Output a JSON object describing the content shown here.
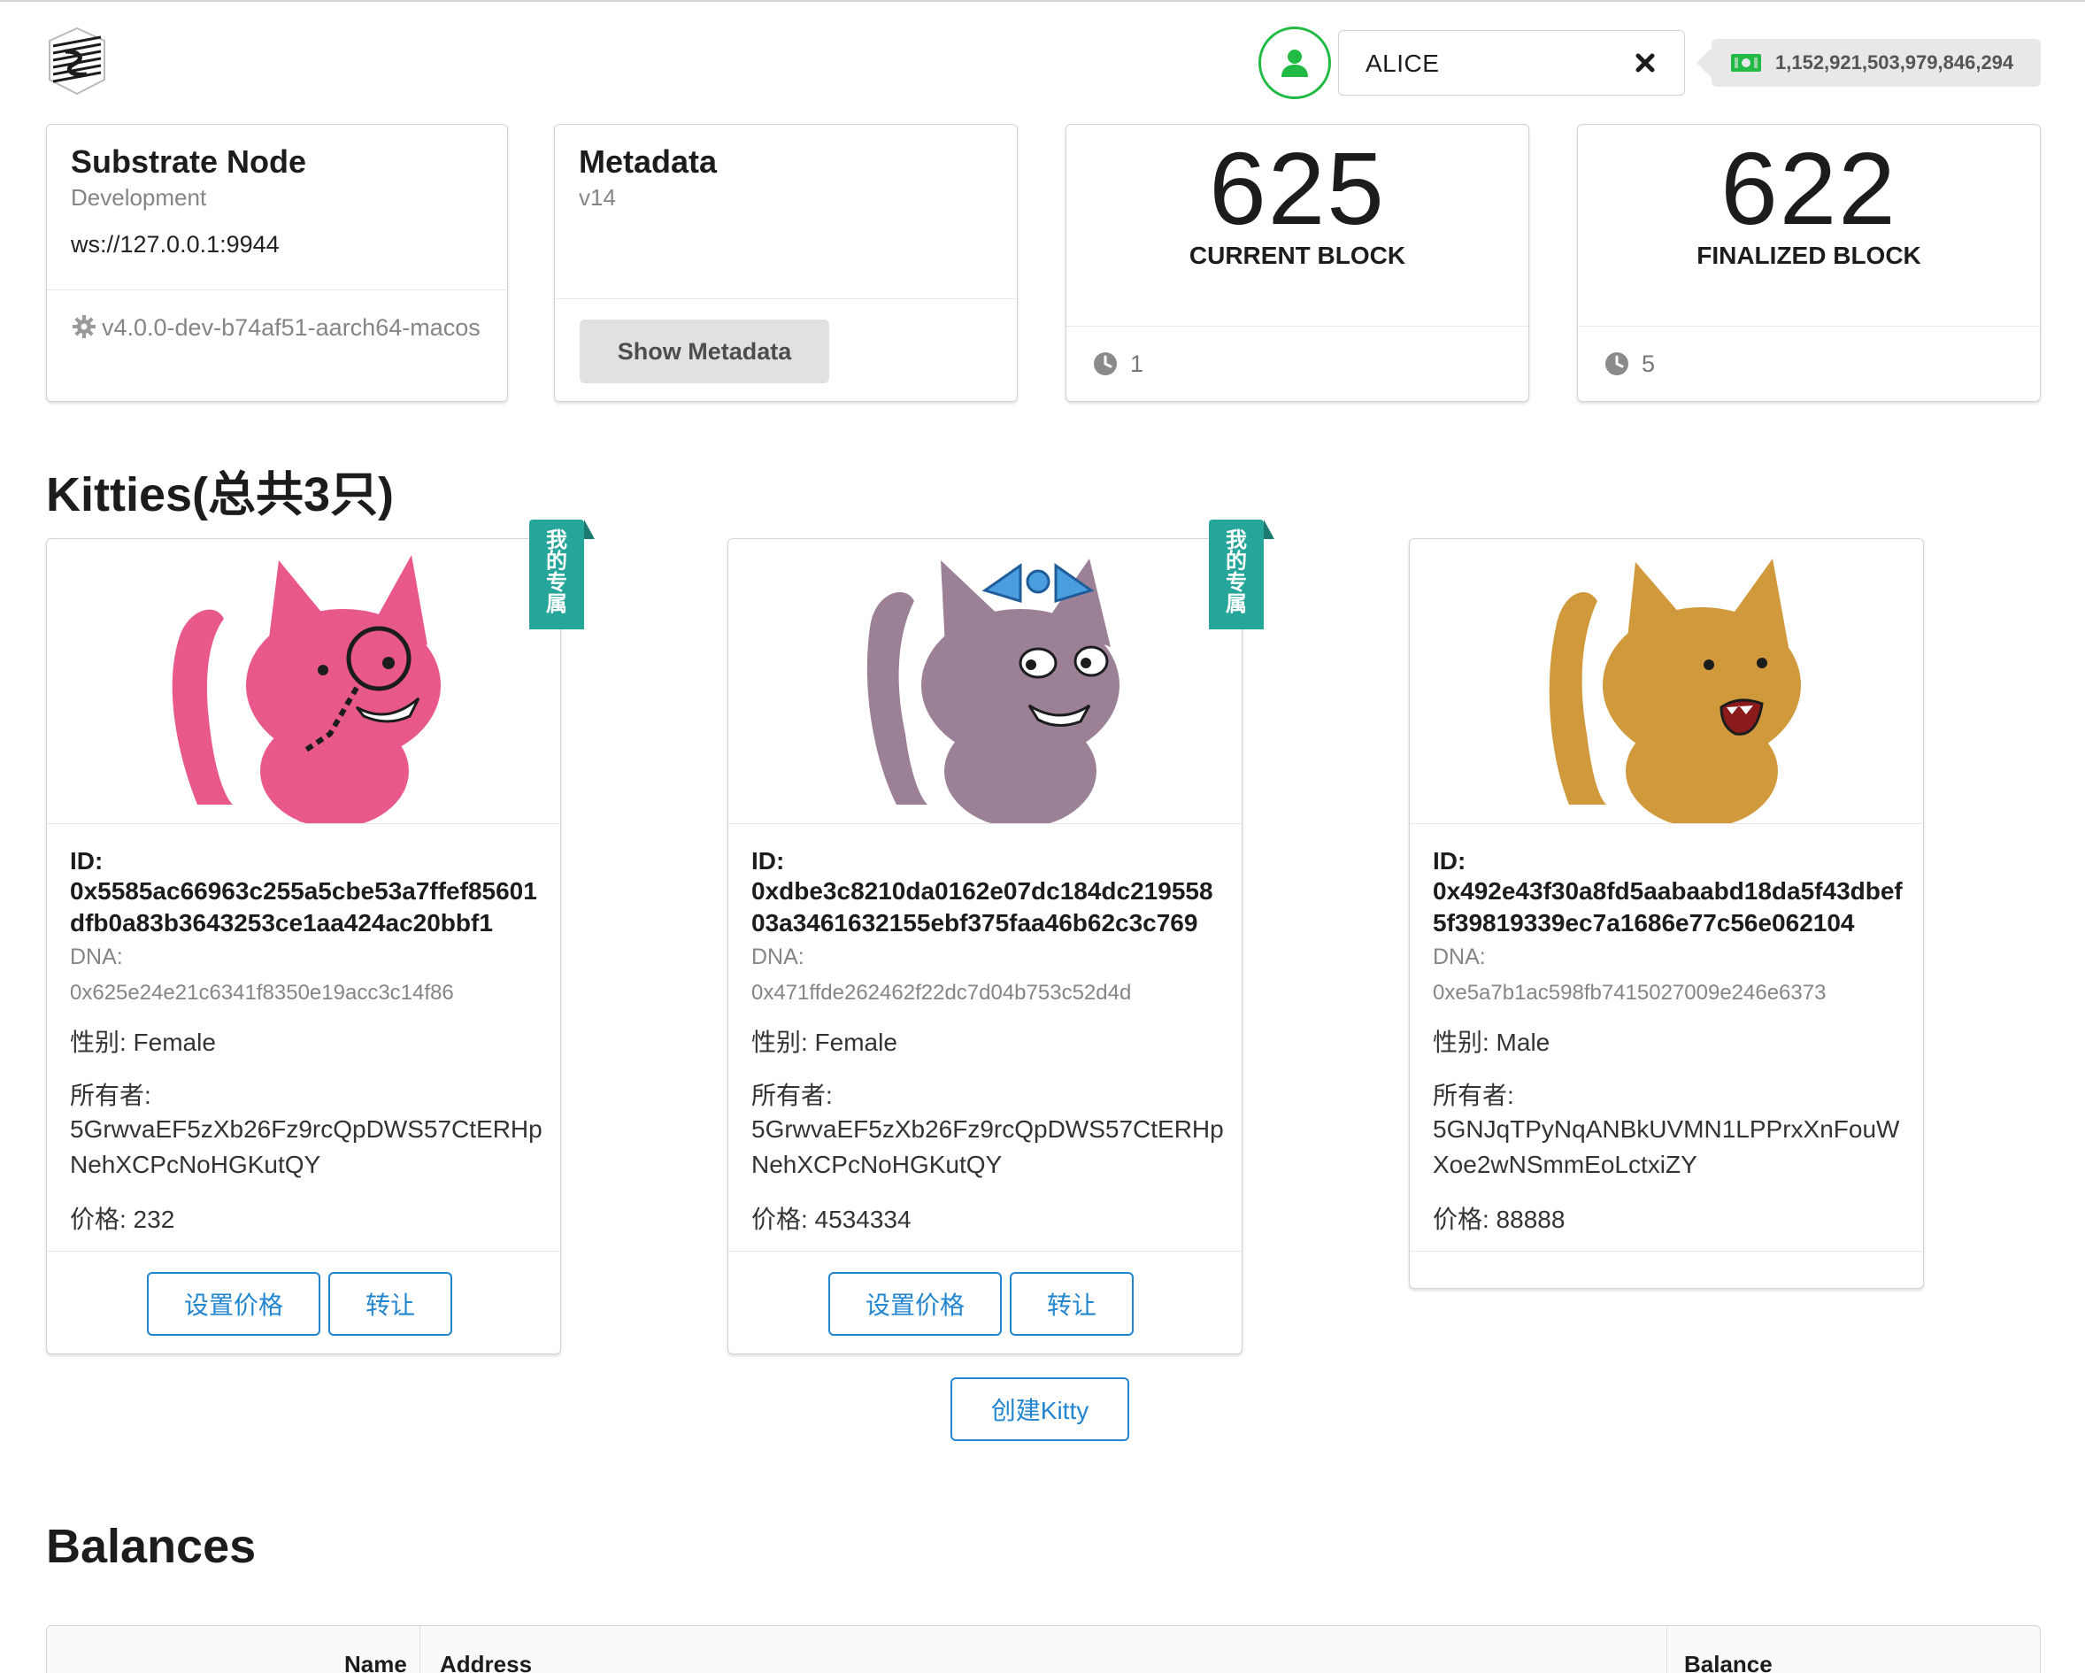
{
  "header": {
    "account_name": "ALICE",
    "balance": "1,152,921,503,979,846,294"
  },
  "node_card": {
    "title": "Substrate Node",
    "chain": "Development",
    "endpoint": "ws://127.0.0.1:9944",
    "version": "v4.0.0-dev-b74af51-aarch64-macos"
  },
  "metadata_card": {
    "title": "Metadata",
    "version": "v14",
    "button": "Show Metadata"
  },
  "current_block": {
    "number": "625",
    "label": "CURRENT BLOCK",
    "timer": "1"
  },
  "finalized_block": {
    "number": "622",
    "label": "FINALIZED BLOCK",
    "timer": "5"
  },
  "kitties": {
    "title": "Kitties(总共3只)",
    "ribbon_text": [
      "我",
      "的",
      "专",
      "属"
    ],
    "create_button": "创建Kitty",
    "set_price_button": "设置价格",
    "transfer_button": "转让",
    "id_label": "ID:",
    "dna_label": "DNA:",
    "items": [
      {
        "id": "0x5585ac66963c255a5cbe53a7ffef85601dfb0a83b3643253ce1aa424ac20bbf1",
        "dna": "0x625e24e21c6341f8350e19acc3c14f86",
        "gender": "性别: Female",
        "owner_label": "所有者:",
        "owner": "5GrwvaEF5zXb26Fz9rcQpDWS57CtERHpNehXCPcNoHGKutQY",
        "price": "价格: 232",
        "color": "#e8588a",
        "mine": true
      },
      {
        "id": "0xdbe3c8210da0162e07dc184dc21955803a3461632155ebf375faa46b62c3c769",
        "dna": "0x471ffde262462f22dc7d04b753c52d4d",
        "gender": "性别: Female",
        "owner_label": "所有者:",
        "owner": "5GrwvaEF5zXb26Fz9rcQpDWS57CtERHpNehXCPcNoHGKutQY",
        "price": "价格: 4534334",
        "color": "#9c8096",
        "mine": true
      },
      {
        "id": "0x492e43f30a8fd5aabaabd18da5f43dbef5f39819339ec7a1686e77c56e062104",
        "dna": "0xe5a7b1ac598fb7415027009e246e6373",
        "gender": "性别: Male",
        "owner_label": "所有者:",
        "owner": "5GNJqTPyNqANBkUVMN1LPPrxXnFouWXoe2wNSmmEoLctxiZY",
        "price": "价格: 88888",
        "color": "#d09a3c",
        "mine": false
      }
    ]
  },
  "balances": {
    "title": "Balances",
    "columns": [
      "Name",
      "Address",
      "Balance"
    ]
  },
  "colors": {
    "primary": "#2185d0",
    "green": "#21ba45",
    "ribbon": "#26a69a"
  },
  "icons": [
    "substrate-logo-icon",
    "user-icon",
    "close-icon",
    "money-icon",
    "gear-icon",
    "clock-icon"
  ]
}
